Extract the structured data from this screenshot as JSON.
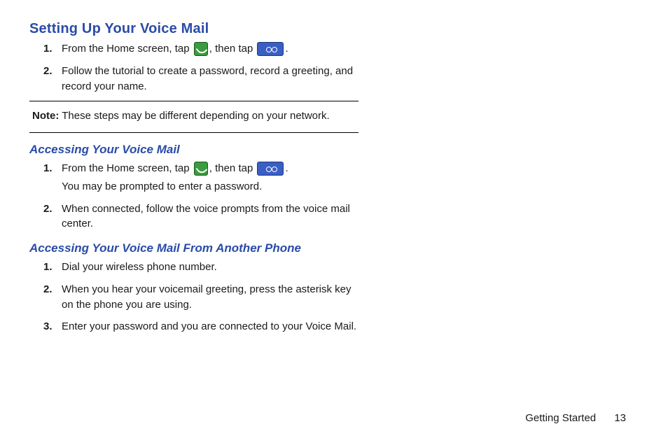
{
  "heading": "Setting Up Your Voice Mail",
  "setup": {
    "step1_a": "From the Home screen, tap ",
    "step1_b": ", then tap ",
    "step1_c": ".",
    "step2": "Follow the tutorial to create a password, record a greeting, and record your name."
  },
  "note": {
    "label": "Note:",
    "text": " These steps may be different depending on your network."
  },
  "access": {
    "heading": "Accessing Your Voice Mail",
    "step1_a": "From the Home screen, tap ",
    "step1_b": ", then tap ",
    "step1_c": ".",
    "step1_sub": "You may be prompted to enter a password.",
    "step2": "When connected, follow the voice prompts from the voice mail center."
  },
  "access_other": {
    "heading": "Accessing Your Voice Mail From Another Phone",
    "step1": "Dial your wireless phone number.",
    "step2": "When you hear your voicemail greeting, press the asterisk key on the phone you are using.",
    "step3": "Enter your password and you are connected to your Voice Mail."
  },
  "nums": {
    "n1": "1.",
    "n2": "2.",
    "n3": "3."
  },
  "footer": {
    "section": "Getting Started",
    "page": "13"
  }
}
